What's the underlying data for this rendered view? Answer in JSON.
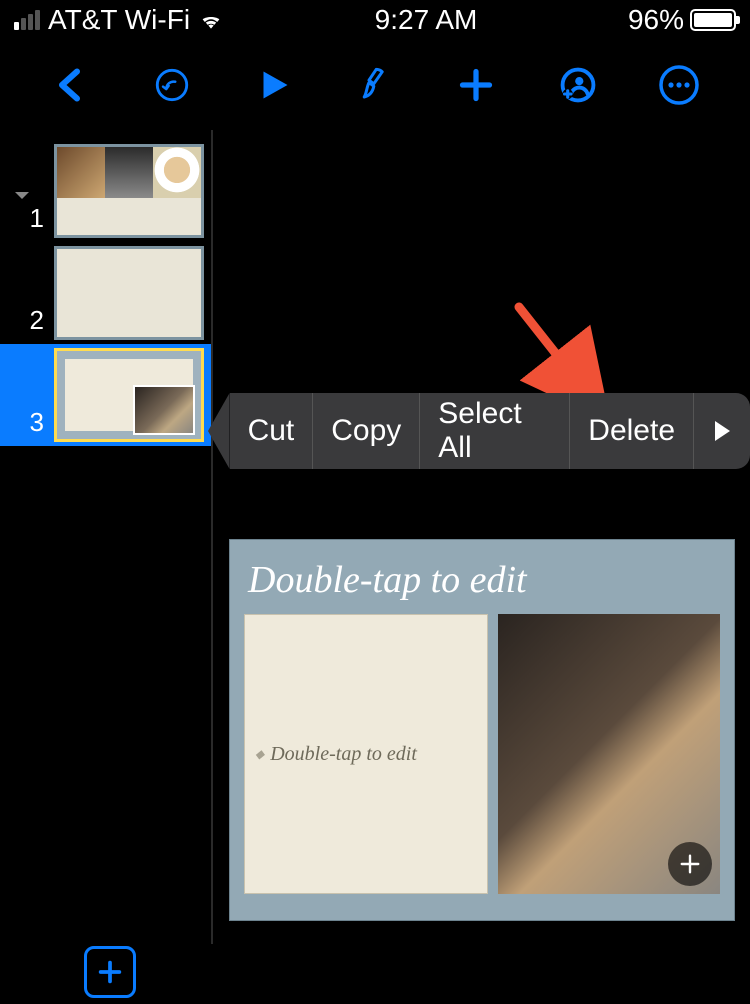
{
  "status": {
    "carrier": "AT&T Wi-Fi",
    "time": "9:27 AM",
    "battery_pct": "96%"
  },
  "toolbar": {
    "back": "Back",
    "undo": "Undo",
    "play": "Play",
    "format": "Format Brush",
    "insert": "Insert",
    "collaborate": "Collaborate",
    "more": "More"
  },
  "slides": [
    {
      "number": "1",
      "selected": false,
      "kind": "triple-photo"
    },
    {
      "number": "2",
      "selected": false,
      "kind": "blank"
    },
    {
      "number": "3",
      "selected": true,
      "kind": "photo-right"
    }
  ],
  "context_menu": {
    "items": [
      "Cut",
      "Copy",
      "Select All",
      "Delete"
    ],
    "more_icon": "play"
  },
  "canvas_slide": {
    "title_placeholder": "Double-tap to edit",
    "body_placeholder": "Double-tap to edit",
    "add_media_icon": "plus"
  },
  "panel": {
    "add_slide_label": "Add Slide",
    "collapse_icon": "chevron-down"
  },
  "colors": {
    "accent": "#0a7cff",
    "menu_bg": "#3a3a3c",
    "annotation": "#f05136"
  }
}
